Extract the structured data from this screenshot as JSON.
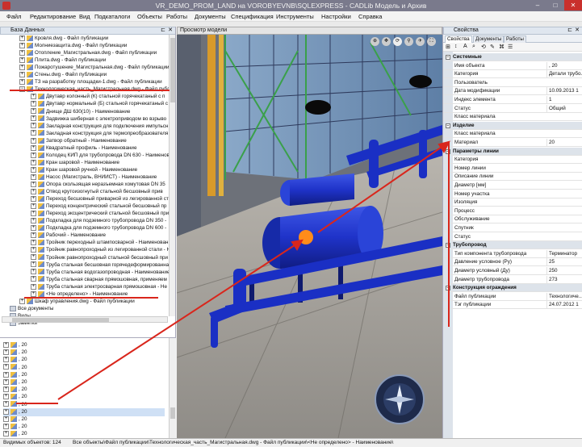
{
  "window": {
    "title": "VR_DEMO_PROM_LAND на VOROBYEVNB\\SQLEXPRESS - CADLib Модель и Архив",
    "minimize": "–",
    "maximize": "□",
    "close": "✕"
  },
  "menu": [
    "Файл",
    "Редактирование",
    "Вид",
    "Подкаталоги",
    "Объекты",
    "Работы",
    "Документы",
    "Спецификация",
    "Инструменты",
    "Настройки",
    "Справка"
  ],
  "tree": {
    "title": "База Данных",
    "rows": [
      {
        "text": "Кровля.dwg - Файл публикации",
        "level": 1,
        "exp": "+",
        "icon": "part"
      },
      {
        "text": "Молниезащита.dwg - Файл публикации",
        "level": 1,
        "exp": "+",
        "icon": "part"
      },
      {
        "text": "Отопление_Магистральная.dwg - Файл публикации",
        "level": 1,
        "exp": "+",
        "icon": "part"
      },
      {
        "text": "Плита.dwg - Файл публикации",
        "level": 1,
        "exp": "+",
        "icon": "part"
      },
      {
        "text": "Пожаротушение_Магистральная.dwg - Файл публикации",
        "level": 1,
        "exp": "+",
        "icon": "part"
      },
      {
        "text": "Стены.dwg - Файл публикации",
        "level": 1,
        "exp": "+",
        "icon": "part"
      },
      {
        "text": "ТЗ на разработку площадки-1.dwg - Файл публикации",
        "level": 1,
        "exp": "+",
        "icon": "part"
      },
      {
        "text": "Технологическая_часть_Магистральная.dwg - Файл публи",
        "level": 1,
        "exp": "−",
        "icon": "part"
      },
      {
        "text": "Двутавр колонный (К) стальной горячекатаный с п",
        "level": 2,
        "exp": "+",
        "icon": "part"
      },
      {
        "text": "Двутавр нормальный (Б) стальной горячекатаный с",
        "level": 2,
        "exp": "+",
        "icon": "part"
      },
      {
        "text": "Днище ДШ 630(10) - Наименование",
        "level": 2,
        "exp": "+",
        "icon": "part"
      },
      {
        "text": "Задвижка шиберная с электроприводом во взрыво",
        "level": 2,
        "exp": "+",
        "icon": "part"
      },
      {
        "text": "Закладная конструкция для подключения импульсн",
        "level": 2,
        "exp": "+",
        "icon": "part"
      },
      {
        "text": "Закладная конструкция для термопреобразователя",
        "level": 2,
        "exp": "+",
        "icon": "part"
      },
      {
        "text": "Затвор обратный - Наименование",
        "level": 2,
        "exp": "+",
        "icon": "part"
      },
      {
        "text": "Квадратный профиль - Наименование",
        "level": 2,
        "exp": "+",
        "icon": "part"
      },
      {
        "text": "Колодец КИП для трубопровода DN 630 - Наименов",
        "level": 2,
        "exp": "+",
        "icon": "part"
      },
      {
        "text": "Кран шаровой - Наименование",
        "level": 2,
        "exp": "+",
        "icon": "part"
      },
      {
        "text": "Кран шаровой ручной - Наименование",
        "level": 2,
        "exp": "+",
        "icon": "part"
      },
      {
        "text": "Насос (Магистраль, ВНИИСТ) - Наименование",
        "level": 2,
        "exp": "+",
        "icon": "part"
      },
      {
        "text": "Опора скользящая неразъемная хомутовая DN 35",
        "level": 2,
        "exp": "+",
        "icon": "part"
      },
      {
        "text": "Отвод крутоизогнутый стальной бесшовный прив",
        "level": 2,
        "exp": "+",
        "icon": "part"
      },
      {
        "text": "Переход бесшовный приварной из легированной ст",
        "level": 2,
        "exp": "+",
        "icon": "part"
      },
      {
        "text": "Переход концентрический стальной бесшовный пр",
        "level": 2,
        "exp": "+",
        "icon": "part"
      },
      {
        "text": "Переход эксцентрический стальной бесшовный при",
        "level": 2,
        "exp": "+",
        "icon": "part"
      },
      {
        "text": "Подкладка для подземного трубопровода DN 350 -",
        "level": 2,
        "exp": "+",
        "icon": "part"
      },
      {
        "text": "Подкладка для подземного трубопровода DN 600 -",
        "level": 2,
        "exp": "+",
        "icon": "part"
      },
      {
        "text": "Рабочий - Наименование",
        "level": 2,
        "exp": "+",
        "icon": "part"
      },
      {
        "text": "Тройник переходный штампосварной - Наименован",
        "level": 2,
        "exp": "+",
        "icon": "part"
      },
      {
        "text": "Тройник равнопроходный из легированной стали - Н",
        "level": 2,
        "exp": "+",
        "icon": "part"
      },
      {
        "text": "Тройник равнопроходный стальной бесшовный при",
        "level": 2,
        "exp": "+",
        "icon": "part"
      },
      {
        "text": "Труба стальная бесшовная горячедеформированна",
        "level": 2,
        "exp": "+",
        "icon": "part"
      },
      {
        "text": "Труба стальная водогазопроводная - Наименование",
        "level": 2,
        "exp": "+",
        "icon": "part"
      },
      {
        "text": "Труба стальная сварная прямошовная, применяем",
        "level": 2,
        "exp": "+",
        "icon": "part"
      },
      {
        "text": "Труба стальная электросварная прямошовная - Не",
        "level": 2,
        "exp": "+",
        "icon": "part"
      },
      {
        "text": "<Не определено> - Наименование",
        "level": 2,
        "exp": "+",
        "icon": "part"
      },
      {
        "text": "Шкаф управления.dwg - Файл публикации",
        "level": 1,
        "exp": "+",
        "icon": "part"
      },
      {
        "text": "Все документы",
        "level": 0,
        "exp": "",
        "icon": "box"
      },
      {
        "text": "Виды",
        "level": 0,
        "exp": "",
        "icon": "box"
      },
      {
        "text": "Заметки",
        "level": 0,
        "exp": "",
        "icon": "box"
      }
    ]
  },
  "bottom_list": {
    "rows": [
      ", 20",
      ", 20",
      ", 20",
      ", 20",
      ", 20",
      ", 20",
      ", 20",
      ", 20",
      ", 20",
      ", 20",
      ", 20",
      ", 20",
      ", 20"
    ],
    "selected_index": 9
  },
  "viewport": {
    "title": "Просмотр модели"
  },
  "properties": {
    "title": "Свойства",
    "tabs": [
      "Свойства",
      "Документы",
      "Работы"
    ],
    "toolbar_icons": [
      "⊞",
      "↕",
      "A",
      "⌕",
      "⟲",
      "✎",
      "⌘",
      "☰"
    ],
    "groups": [
      {
        "name": "Системные",
        "rows": [
          {
            "k": "Имя объекта",
            "v": ", 20"
          },
          {
            "k": "Категория",
            "v": "Детали трубо..."
          },
          {
            "k": "Пользователь",
            "v": ""
          },
          {
            "k": "Дата модификации",
            "v": "10.09.2013 1"
          },
          {
            "k": "Индекс элемента",
            "v": "1"
          },
          {
            "k": "Статус",
            "v": "Общий"
          },
          {
            "k": "Класс материала",
            "v": ""
          }
        ]
      },
      {
        "name": "Изделие",
        "rows": [
          {
            "k": "Класс материала",
            "v": ""
          },
          {
            "k": "Материал",
            "v": "20"
          }
        ]
      },
      {
        "name": "Параметры линии",
        "rows": [
          {
            "k": "Категория",
            "v": ""
          },
          {
            "k": "Номер линии",
            "v": ""
          },
          {
            "k": "Описание линии",
            "v": ""
          },
          {
            "k": "Диаметр [мм]",
            "v": ""
          },
          {
            "k": "Номер участка",
            "v": ""
          },
          {
            "k": "Изоляция",
            "v": ""
          },
          {
            "k": "Процесс",
            "v": ""
          },
          {
            "k": "Обслуживание",
            "v": ""
          },
          {
            "k": "Спутник",
            "v": ""
          },
          {
            "k": "Статус",
            "v": ""
          }
        ]
      },
      {
        "name": "Трубопровод",
        "rows": [
          {
            "k": "Тип компонента трубопровода",
            "v": "Терминатор"
          },
          {
            "k": "Давление условное (Ру)",
            "v": "25"
          },
          {
            "k": "Диаметр условный (Ду)",
            "v": "250"
          },
          {
            "k": "Диаметр трубопровода",
            "v": "273"
          }
        ]
      },
      {
        "name": "Конструкция ограждения",
        "rows": [
          {
            "k": "Файл публикации",
            "v": "Технологиче..."
          },
          {
            "k": "Тэг публикации",
            "v": "24.07.2012 1"
          }
        ]
      }
    ]
  },
  "status": {
    "visible_objects": "Видимых объектов: 124",
    "path": "Все объекты\\Файл публикации\\Технологическая_часть_Магистральная.dwg - Файл публикации\\<Не определено> - Наименование\\"
  },
  "colors": {
    "annotation": "#d9261c",
    "pipe": "#1a2fc4",
    "frame_green": "#3aa04a",
    "highlight": "#ff8c1a"
  }
}
